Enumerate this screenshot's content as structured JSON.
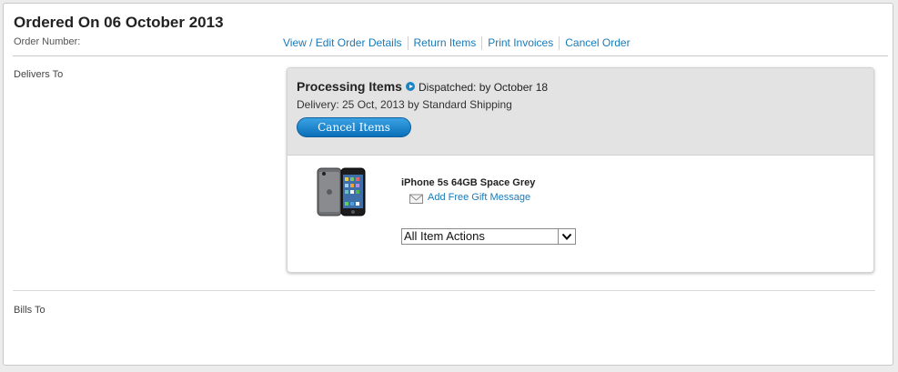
{
  "order": {
    "title": "Ordered On 06 October 2013",
    "number_label": "Order Number:"
  },
  "actions": [
    {
      "label": "View / Edit Order Details"
    },
    {
      "label": "Return Items"
    },
    {
      "label": "Print Invoices"
    },
    {
      "label": "Cancel Order"
    }
  ],
  "sections": {
    "delivers_to": "Delivers To",
    "bills_to": "Bills To"
  },
  "shipment": {
    "status": "Processing Items",
    "dispatched": "Dispatched: by October 18",
    "delivery": "Delivery: 25 Oct, 2013 by Standard Shipping",
    "cancel_button": "Cancel Items"
  },
  "item": {
    "name": "iPhone 5s 64GB Space Grey",
    "gift_link": "Add Free Gift Message",
    "actions_select": "All Item Actions",
    "image_icon": "iphone-product-icon"
  },
  "colors": {
    "link": "#1a7ab8",
    "button": "#1a85c6",
    "header_bg": "#e3e3e3"
  }
}
